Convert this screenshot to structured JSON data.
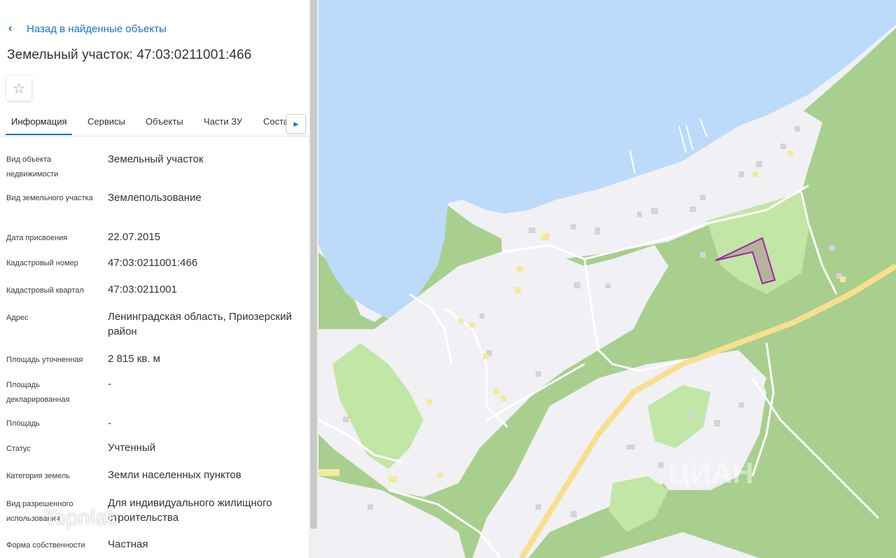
{
  "nav": {
    "back_label": "Назад в найденные объекты"
  },
  "header": {
    "title": "Земельный участок: 47:03:0211001:466",
    "favorite_icon": "star-outline-icon"
  },
  "tabs": [
    {
      "label": "Информация",
      "active": true
    },
    {
      "label": "Сервисы"
    },
    {
      "label": "Объекты"
    },
    {
      "label": "Части ЗУ"
    },
    {
      "label": "Соста"
    }
  ],
  "tabs_scroll_icon": "caret-right-icon",
  "details": [
    {
      "label": "Вид объекта недвижимости",
      "value": "Земельный участок"
    },
    {
      "label": "Вид земельного участка",
      "value": "Землепользование"
    },
    {
      "label": "Дата присвоения",
      "value": "22.07.2015"
    },
    {
      "label": "Кадастровый номер",
      "value": "47:03:0211001:466"
    },
    {
      "label": "Кадастровый квартал",
      "value": "47:03:0211001"
    },
    {
      "label": "Адрес",
      "value": "Ленинградская область, Приозерский район"
    },
    {
      "label": "Площадь уточненная",
      "value": "2 815 кв. м"
    },
    {
      "label": "Площадь декларированная",
      "value": "-"
    },
    {
      "label": "Площадь",
      "value": "-"
    },
    {
      "label": "Статус",
      "value": "Учтенный"
    },
    {
      "label": "Категория земель",
      "value": "Земли населенных пунктов"
    },
    {
      "label": "Вид разрешенного использования",
      "value": "Для индивидуального жилищного строительства"
    },
    {
      "label": "Форма собственности",
      "value": "Частная"
    }
  ],
  "watermark": "Topnlab",
  "map": {
    "colors": {
      "water": "#bcdafa",
      "forest": "#a8cf8e",
      "meadow": "#c2e6a5",
      "settlement": "#f1f0f5",
      "road_major": "#f7df8f",
      "road_minor": "#ffffff",
      "parcel_fill": "#b5b39a",
      "parcel_stroke": "#a020b0",
      "building": "#d3d3d8",
      "building_alt": "#f4ea9a"
    },
    "map_watermark": "ЦИАН"
  }
}
